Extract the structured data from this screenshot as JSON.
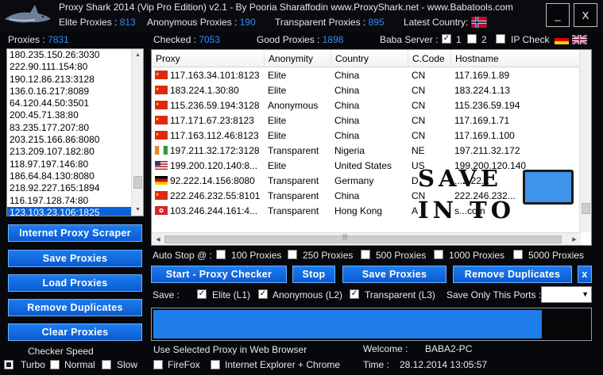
{
  "window": {
    "title": "Proxy Shark 2014 (Vip Pro Edition) v2.1 - By Pooria Sharaffodin  www.ProxyShark.net  -  www.Babatools.com",
    "minimize_label": "_",
    "close_label": "X"
  },
  "stats": {
    "elite_label": "Elite Proxies :",
    "elite_count": "813",
    "anonymous_label": "Anonymous  Proxies :",
    "anonymous_count": "190",
    "transparent_label": "Transparent Proxies :",
    "transparent_count": "895",
    "latest_country_label": "Latest Country:"
  },
  "proxies_panel": {
    "label": "Proxies :",
    "count": "7831",
    "items": [
      "180.235.150.26:3030",
      "222.90.111.154:80",
      "190.12.86.213:3128",
      "136.0.16.217:8089",
      "64.120.44.50:3501",
      "200.45.71.38:80",
      "83.235.177.207:80",
      "203.215.166.86:8080",
      "213.209.107.182:80",
      "118.97.197.146:80",
      "186.64.84.130:8080",
      "218.92.227.165:1894",
      "116.197.128.74:80",
      "123.103.23.106:1825"
    ],
    "selected_index": 13
  },
  "checked_bar": {
    "checked_label": "Checked :",
    "checked_count": "7053",
    "good_label": "Good Proxies :",
    "good_count": "1898",
    "baba_server_label": "Baba Server :",
    "server_1": "1",
    "server_2": "2",
    "ip_check_label": "IP Check"
  },
  "grid": {
    "columns": [
      "Proxy",
      "Anonymity",
      "Country",
      "C.Code",
      "Hostname"
    ],
    "rows": [
      {
        "flag": "cn",
        "proxy": "117.163.34.101:8123",
        "anonymity": "Elite",
        "country": "China",
        "code": "CN",
        "hostname": "117.169.1.89"
      },
      {
        "flag": "cn",
        "proxy": "183.224.1.30:80",
        "anonymity": "Elite",
        "country": "China",
        "code": "CN",
        "hostname": "183.224.1.13"
      },
      {
        "flag": "cn",
        "proxy": "115.236.59.194:3128",
        "anonymity": "Anonymous",
        "country": "China",
        "code": "CN",
        "hostname": "115.236.59.194"
      },
      {
        "flag": "cn",
        "proxy": "117.171.67.23:8123",
        "anonymity": "Elite",
        "country": "China",
        "code": "CN",
        "hostname": "117.169.1.71"
      },
      {
        "flag": "cn",
        "proxy": "117.163.112.46:8123",
        "anonymity": "Elite",
        "country": "China",
        "code": "CN",
        "hostname": "117.169.1.100"
      },
      {
        "flag": "ng",
        "proxy": "197.211.32.172:3128",
        "anonymity": "Transparent",
        "country": "Nigeria",
        "code": "NE",
        "hostname": "197.211.32.172"
      },
      {
        "flag": "us",
        "proxy": "199.200.120.140:8...",
        "anonymity": "Elite",
        "country": "United States",
        "code": "US",
        "hostname": "199.200.120.140"
      },
      {
        "flag": "de",
        "proxy": "92.222.14.156:8080",
        "anonymity": "Transparent",
        "country": "Germany",
        "code": "D",
        "hostname": "...2-22..."
      },
      {
        "flag": "cn",
        "proxy": "222.246.232.55:8101",
        "anonymity": "Transparent",
        "country": "China",
        "code": "CN",
        "hostname": "222.246.232..."
      },
      {
        "flag": "hk",
        "proxy": "103.246.244.161:4...",
        "anonymity": "Transparent",
        "country": "Hong Kong",
        "code": "A",
        "hostname": "s...com"
      }
    ],
    "hscroll_grip": "|||"
  },
  "watermark": {
    "line1": "SAVE",
    "line2": "IN TO"
  },
  "left_buttons": {
    "scraper": "Internet Proxy Scraper",
    "save": "Save Proxies",
    "load": "Load Proxies",
    "remove_duplicates": "Remove Duplicates",
    "clear": "Clear Proxies"
  },
  "auto_stop": {
    "label": "Auto Stop @ :",
    "options": [
      "100 Proxies",
      "250 Proxies",
      "500 Proxies",
      "1000 Proxies",
      "5000 Proxies"
    ]
  },
  "action_buttons": {
    "start": "Start - Proxy Checker",
    "stop": "Stop",
    "save": "Save Proxies",
    "remove_duplicates": "Remove Duplicates",
    "close": "x"
  },
  "save_options": {
    "label": "Save :",
    "elite": "Elite (L1)",
    "anonymous": "Anonymous (L2)",
    "transparent": "Transparent (L3)",
    "only_ports_label": "Save Only This Ports :",
    "ports_value": ""
  },
  "progress": {
    "fraction": 0.89
  },
  "checker_speed": {
    "label": "Checker Speed",
    "turbo": "Turbo",
    "normal": "Normal",
    "slow": "Slow"
  },
  "browser": {
    "label": "Use Selected Proxy in Web Browser",
    "firefox": "FireFox",
    "ie_chrome": "Internet Explorer + Chrome"
  },
  "footer": {
    "welcome_label": "Welcome :",
    "welcome_value": "BABA2-PC",
    "time_label": "Time :",
    "time_value": "28.12.2014 13:05:57"
  },
  "colors": {
    "accent": "#2c8cff",
    "button": "#0b5bd0",
    "background": "#07080b"
  }
}
